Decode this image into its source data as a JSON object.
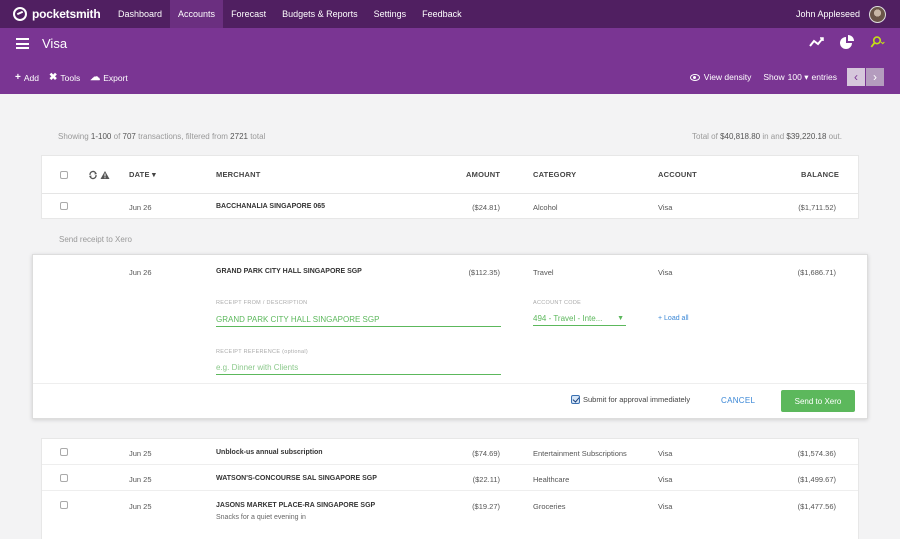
{
  "app": {
    "name": "pocketsmith"
  },
  "nav": {
    "items": [
      "Dashboard",
      "Accounts",
      "Forecast",
      "Budgets & Reports",
      "Settings",
      "Feedback"
    ],
    "active": "Accounts"
  },
  "user": {
    "name": "John Appleseed"
  },
  "header": {
    "title": "Visa",
    "toolbar": {
      "add": "Add",
      "tools": "Tools",
      "export": "Export"
    },
    "view_density": "View density",
    "show_label": "Show",
    "show_value": "100",
    "entries_label": "entries"
  },
  "summary": {
    "showing_prefix": "Showing",
    "range": "1-100",
    "of": "of",
    "count": "707",
    "filtered_text": "transactions, filtered from",
    "total_count": "2721",
    "total_word": "total",
    "total_prefix": "Total of",
    "total_in": "$40,818.80",
    "in_word": "in and",
    "total_out": "$39,220.18",
    "out_word": "out."
  },
  "columns": {
    "date": "DATE",
    "merchant": "MERCHANT",
    "amount": "AMOUNT",
    "category": "CATEGORY",
    "account": "ACCOUNT",
    "balance": "BALANCE"
  },
  "top_rows": [
    {
      "date": "Jun 26",
      "merchant": "BACCHANALIA SINGAPORE 065",
      "amount": "($24.81)",
      "category": "Alcohol",
      "account": "Visa",
      "balance": "($1,711.52)"
    }
  ],
  "xero": {
    "send_label": "Send receipt to Xero",
    "transaction": {
      "date": "Jun 26",
      "merchant": "GRAND PARK CITY HALL SINGAPORE SGP",
      "amount": "($112.35)",
      "category": "Travel",
      "account": "Visa",
      "balance": "($1,686.71)"
    },
    "receipt_from_label": "RECEIPT FROM / DESCRIPTION",
    "receipt_from_value": "GRAND PARK CITY HALL SINGAPORE SGP",
    "account_code_label": "ACCOUNT CODE",
    "account_code_value": "494 - Travel - Inte...",
    "load_all": "+ Load all",
    "reference_label": "RECEIPT REFERENCE (optional)",
    "reference_placeholder": "e.g. Dinner with Clients",
    "submit_label": "Submit for approval immediately",
    "cancel": "CANCEL",
    "send_button": "Send to Xero"
  },
  "bottom_rows": [
    {
      "date": "Jun 25",
      "merchant": "Unblock-us annual subscription",
      "note": "",
      "amount": "($74.69)",
      "category": "Entertainment Subscriptions",
      "account": "Visa",
      "balance": "($1,574.36)"
    },
    {
      "date": "Jun 25",
      "merchant": "WATSON'S-CONCOURSE SAL SINGAPORE SGP",
      "note": "",
      "amount": "($22.11)",
      "category": "Healthcare",
      "account": "Visa",
      "balance": "($1,499.67)"
    },
    {
      "date": "Jun 25",
      "merchant": "JASONS MARKET PLACE-RA SINGAPORE SGP",
      "note": "Snacks for a quiet evening in",
      "amount": "($19.27)",
      "category": "Groceries",
      "account": "Visa",
      "balance": "($1,477.56)"
    }
  ],
  "icons": {
    "trend": "trend-line-icon",
    "pie": "pie-chart-icon",
    "search": "search-icon",
    "sync": "sync-icon",
    "warning": "warning-icon"
  },
  "colors": {
    "nav_bg": "#501f61",
    "header_bg": "#7a3593",
    "accent_green": "#5cb85c",
    "link_blue": "#3a87d6",
    "search_icon": "#c4e016"
  }
}
